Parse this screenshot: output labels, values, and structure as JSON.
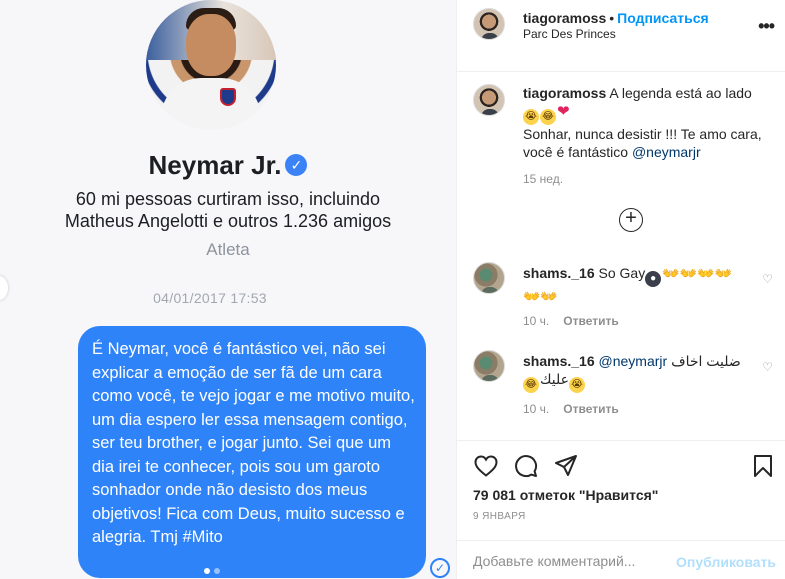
{
  "media": {
    "profile_name": "Neymar Jr.",
    "likes_line_1": "60 mi pessoas curtiram isso, incluindo",
    "likes_line_2": "Matheus Angelotti e outros 1.236 amigos",
    "category": "Atleta",
    "message_timestamp": "04/01/2017 17:53",
    "message_text": "É Neymar, você é fantástico vei, não sei explicar a emoção de ser fã de um cara como você, te vejo jogar e me motivo muito, um dia espero ler essa mensagem contigo, ser teu brother, e jogar junto. Sei que um dia irei te conhecer, pois sou um garoto sonhador onde não desisto dos meus objetivos! Fica com Deus, muito sucesso e alegria. Tmj #Mito",
    "accent_color": "#2e83f8"
  },
  "header": {
    "username": "tiagoramoss",
    "separator": "•",
    "follow_label": "Подписаться",
    "location": "Parc Des Princes",
    "more_label": "•••"
  },
  "caption": {
    "username": "tiagoramoss",
    "text_1": "A legenda está ao lado",
    "text_2": "Sonhar, nunca desistir !!! Te amo cara, você é fantástico",
    "mention": "@neymarjr",
    "age": "15 нед."
  },
  "comments": [
    {
      "username": "shams._16",
      "text": "So Gay",
      "age": "10 ч.",
      "reply_label": "Ответить"
    },
    {
      "username": "shams._16",
      "mention": "@neymarjr",
      "text": "ضليت اخاف",
      "text_2": "عليك",
      "age": "10 ч.",
      "reply_label": "Ответить"
    }
  ],
  "actions": {
    "likes_text": "79 081 отметок \"Нравится\"",
    "date": "9 ЯНВАРЯ",
    "icons": [
      "heart-icon",
      "comment-icon",
      "share-icon",
      "bookmark-icon"
    ]
  },
  "add_comment": {
    "placeholder": "Добавьте комментарий...",
    "publish_label": "Опубликовать"
  },
  "colors": {
    "link": "#00376b",
    "follow": "#0095f6",
    "muted": "#8e8e8e"
  }
}
